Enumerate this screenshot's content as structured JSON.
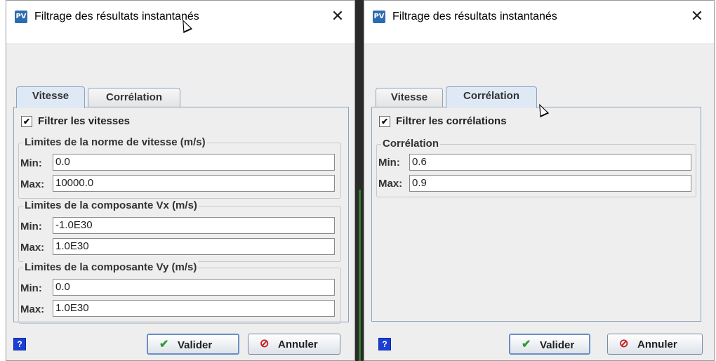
{
  "left_dialog": {
    "title": "Filtrage des résultats instantanés",
    "app_icon_text": "PV",
    "close_glyph": "✕",
    "tabs": [
      {
        "label": "Vitesse",
        "active": true
      },
      {
        "label": "Corrélation",
        "active": false
      }
    ],
    "filter_checkbox": {
      "label": "Filtrer les vitesses",
      "checked": true,
      "glyph": "✔"
    },
    "groups": [
      {
        "title": "Limites de la norme de vitesse (m/s)",
        "min_label": "Min:",
        "min_value": "0.0",
        "max_label": "Max:",
        "max_value": "10000.0"
      },
      {
        "title": "Limites de la composante Vx (m/s)",
        "min_label": "Min:",
        "min_value": "-1.0E30",
        "max_label": "Max:",
        "max_value": "1.0E30"
      },
      {
        "title": "Limites de la composante Vy (m/s)",
        "min_label": "Min:",
        "min_value": "0.0",
        "max_label": "Max:",
        "max_value": "1.0E30"
      }
    ],
    "help_glyph": "?",
    "valider_label": "Valider",
    "valider_icon": "✔",
    "annuler_label": "Annuler",
    "annuler_icon": "⊘"
  },
  "right_dialog": {
    "title": "Filtrage des résultats instantanés",
    "app_icon_text": "PV",
    "close_glyph": "✕",
    "tabs": [
      {
        "label": "Vitesse",
        "active": false
      },
      {
        "label": "Corrélation",
        "active": true
      }
    ],
    "filter_checkbox": {
      "label": "Filtrer les corrélations",
      "checked": true,
      "glyph": "✔"
    },
    "group": {
      "title": "Corrélation",
      "min_label": "Min:",
      "min_value": "0.6",
      "max_label": "Max:",
      "max_value": "0.9"
    },
    "help_glyph": "?",
    "valider_label": "Valider",
    "valider_icon": "✔",
    "annuler_label": "Annuler",
    "annuler_icon": "⊘"
  },
  "colors": {
    "tab_border": "#8da4be",
    "help_blue": "#1b3fd6",
    "check_green": "#2e9a2e",
    "cancel_red": "#c42222"
  }
}
